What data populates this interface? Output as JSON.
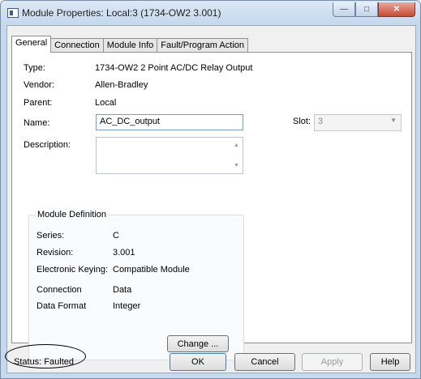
{
  "window": {
    "title": "Module Properties: Local:3 (1734-OW2 3.001)",
    "buttons": [
      "minimize",
      "maximize",
      "close"
    ]
  },
  "tabs": [
    {
      "label": "General",
      "active": true
    },
    {
      "label": "Connection",
      "active": false
    },
    {
      "label": "Module Info",
      "active": false
    },
    {
      "label": "Fault/Program Action",
      "active": false
    }
  ],
  "general": {
    "type_label": "Type:",
    "type_value": "1734-OW2 2 Point AC/DC Relay Output",
    "vendor_label": "Vendor:",
    "vendor_value": "Allen-Bradley",
    "parent_label": "Parent:",
    "parent_value": "Local",
    "name_label": "Name:",
    "name_value": "AC_DC_output",
    "slot_label": "Slot:",
    "slot_value": "3",
    "description_label": "Description:",
    "description_value": ""
  },
  "module_definition": {
    "title": "Module Definition",
    "series_label": "Series:",
    "series_value": "C",
    "revision_label": "Revision:",
    "revision_value": "3.001",
    "keying_label": "Electronic Keying:",
    "keying_value": "Compatible Module",
    "connection_label": "Connection",
    "connection_value": "Data",
    "data_format_label": "Data Format",
    "data_format_value": "Integer",
    "change_button": "Change ..."
  },
  "footer": {
    "status_text": "Status:  Faulted",
    "ok": "OK",
    "cancel": "Cancel",
    "apply": "Apply",
    "help": "Help"
  }
}
